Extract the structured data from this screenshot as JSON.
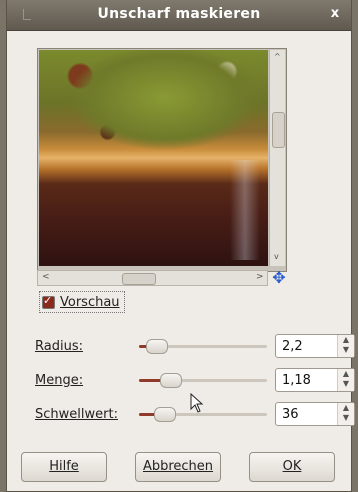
{
  "dialog": {
    "title": "Unscharf maskieren",
    "close_label": "x"
  },
  "preview": {
    "checkbox_label": "Vorschau",
    "checked": true,
    "arrows": {
      "up": "^",
      "down": "v",
      "left": "<",
      "right": ">"
    }
  },
  "params": [
    {
      "label": "Radius:",
      "value": "2,2",
      "slider_fraction": 0.07
    },
    {
      "label": "Menge:",
      "value": "1,18",
      "slider_fraction": 0.2
    },
    {
      "label": "Schwellwert:",
      "value": "36",
      "slider_fraction": 0.14
    }
  ],
  "buttons": {
    "help": "Hilfe",
    "cancel": "Abbrechen",
    "ok": "OK"
  },
  "colors": {
    "accent": "#8f3a2b",
    "nav_icon": "#2a5ccc"
  }
}
